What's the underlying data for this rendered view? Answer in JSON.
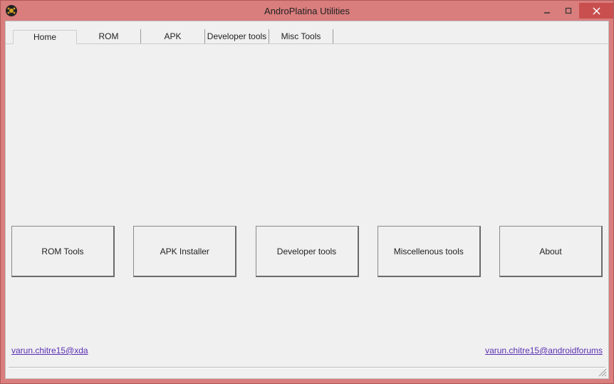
{
  "window": {
    "title": "AndroPlatina Utilities"
  },
  "tabs": [
    {
      "label": "Home"
    },
    {
      "label": "ROM"
    },
    {
      "label": "APK"
    },
    {
      "label": "Developer tools"
    },
    {
      "label": "Misc Tools"
    }
  ],
  "buttons": [
    {
      "label": "ROM Tools"
    },
    {
      "label": "APK Installer"
    },
    {
      "label": "Developer tools"
    },
    {
      "label": "Miscellenous tools"
    },
    {
      "label": "About"
    }
  ],
  "links": {
    "left": "varun.chitre15@xda",
    "right": "varun.chitre15@androidforums"
  }
}
